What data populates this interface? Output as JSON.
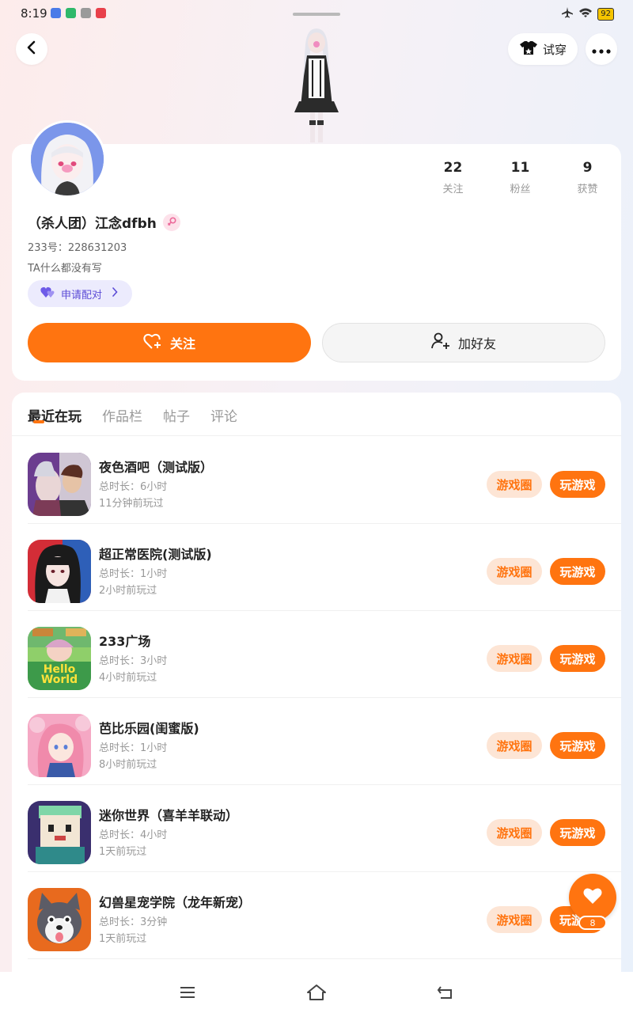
{
  "status_bar": {
    "time": "8:19",
    "battery": "92"
  },
  "header": {
    "tryon_label": "试穿"
  },
  "profile": {
    "stats": [
      {
        "value": "22",
        "label": "关注"
      },
      {
        "value": "11",
        "label": "粉丝"
      },
      {
        "value": "9",
        "label": "获赞"
      }
    ],
    "username": "（杀人团）江念dfbh",
    "uid": "233号：228631203",
    "bio": "TA什么都没有写",
    "pair_label": "申请配对",
    "follow_label": "关注",
    "add_friend_label": "加好友"
  },
  "tabs": [
    "最近在玩",
    "作品栏",
    "帖子",
    "评论"
  ],
  "games": [
    {
      "name": "夜色酒吧（测试版）",
      "duration": "总时长：6小时",
      "last_played": "11分钟前玩过",
      "circle_label": "游戏圈",
      "play_label": "玩游戏"
    },
    {
      "name": "超正常医院(测试版)",
      "duration": "总时长：1小时",
      "last_played": "2小时前玩过",
      "circle_label": "游戏圈",
      "play_label": "玩游戏"
    },
    {
      "name": "233广场",
      "duration": "总时长：3小时",
      "last_played": "4小时前玩过",
      "circle_label": "游戏圈",
      "play_label": "玩游戏",
      "icon_text": "Hello World"
    },
    {
      "name": "芭比乐园(闺蜜版)",
      "duration": "总时长：1小时",
      "last_played": "8小时前玩过",
      "circle_label": "游戏圈",
      "play_label": "玩游戏"
    },
    {
      "name": "迷你世界（喜羊羊联动）",
      "duration": "总时长：4小时",
      "last_played": "1天前玩过",
      "circle_label": "游戏圈",
      "play_label": "玩游戏"
    },
    {
      "name": "幻兽星宠学院（龙年新宠）",
      "duration": "总时长：3分钟",
      "last_played": "1天前玩过",
      "circle_label": "游戏圈",
      "play_label": "玩游"
    }
  ],
  "fab": {
    "count": "8"
  },
  "colors": {
    "accent": "#ff7410",
    "accent_light": "#fde5d5",
    "pair_bg": "#ecebfd",
    "pair_text": "#5b4bd6"
  },
  "icons": {
    "back": "chevron-left-icon",
    "tryon": "tshirt-icon",
    "more": "more-dots-icon",
    "gender": "female-icon",
    "pair": "heart-pair-icon",
    "follow": "heart-plus-icon",
    "add_friend": "user-plus-icon",
    "fab": "heart-icon",
    "nav": [
      "menu-icon",
      "home-icon",
      "back-arrow-icon"
    ]
  }
}
